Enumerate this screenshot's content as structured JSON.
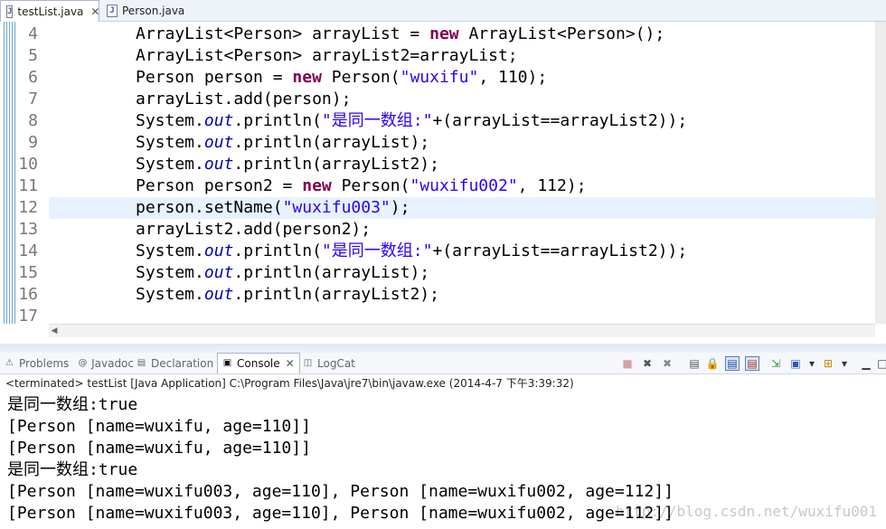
{
  "editor_tabs": [
    {
      "label": "testList.java",
      "icon": "java-file-icon",
      "active": true,
      "close": "✕"
    },
    {
      "label": "Person.java",
      "icon": "java-file-icon",
      "active": false
    }
  ],
  "code_lines": [
    {
      "num": "4",
      "segments": [
        [
          "ArrayList<Person> arrayList = ",
          "p"
        ],
        [
          "new",
          "kw"
        ],
        [
          " ArrayList<Person>();",
          "p"
        ]
      ]
    },
    {
      "num": "5",
      "segments": [
        [
          "ArrayList<Person> arrayList2=arrayList;",
          "p"
        ]
      ]
    },
    {
      "num": "6",
      "segments": [
        [
          "Person person = ",
          "p"
        ],
        [
          "new",
          "kw"
        ],
        [
          " Person(",
          "p"
        ],
        [
          "\"wuxifu\"",
          "str"
        ],
        [
          ", 110);",
          "p"
        ]
      ]
    },
    {
      "num": "7",
      "segments": [
        [
          "arrayList.add(person);",
          "p"
        ]
      ]
    },
    {
      "num": "8",
      "segments": [
        [
          "System.",
          "p"
        ],
        [
          "out",
          "fld"
        ],
        [
          ".println(",
          "p"
        ],
        [
          "\"是同一数组:\"",
          "str"
        ],
        [
          "+(arrayList==arrayList2));",
          "p"
        ]
      ]
    },
    {
      "num": "9",
      "segments": [
        [
          "System.",
          "p"
        ],
        [
          "out",
          "fld"
        ],
        [
          ".println(arrayList);",
          "p"
        ]
      ]
    },
    {
      "num": "10",
      "segments": [
        [
          "System.",
          "p"
        ],
        [
          "out",
          "fld"
        ],
        [
          ".println(arrayList2);",
          "p"
        ]
      ]
    },
    {
      "num": "11",
      "segments": [
        [
          "Person person2 = ",
          "p"
        ],
        [
          "new",
          "kw"
        ],
        [
          " Person(",
          "p"
        ],
        [
          "\"wuxifu002\"",
          "str"
        ],
        [
          ", 112);",
          "p"
        ]
      ]
    },
    {
      "num": "12",
      "current": true,
      "segments": [
        [
          "person.setName(",
          "p"
        ],
        [
          "\"wuxifu003\"",
          "str"
        ],
        [
          ");",
          "p"
        ]
      ]
    },
    {
      "num": "13",
      "segments": [
        [
          "arrayList2.add(person2);",
          "p"
        ]
      ]
    },
    {
      "num": "14",
      "segments": [
        [
          "System.",
          "p"
        ],
        [
          "out",
          "fld"
        ],
        [
          ".println(",
          "p"
        ],
        [
          "\"是同一数组:\"",
          "str"
        ],
        [
          "+(arrayList==arrayList2));",
          "p"
        ]
      ]
    },
    {
      "num": "15",
      "segments": [
        [
          "System.",
          "p"
        ],
        [
          "out",
          "fld"
        ],
        [
          ".println(arrayList);",
          "p"
        ]
      ]
    },
    {
      "num": "16",
      "segments": [
        [
          "System.",
          "p"
        ],
        [
          "out",
          "fld"
        ],
        [
          ".println(arrayList2);",
          "p"
        ]
      ]
    },
    {
      "num": "17",
      "segments": []
    }
  ],
  "view_tabs": [
    {
      "label": "Problems",
      "icon": "problems-icon",
      "glyph": "⚠"
    },
    {
      "label": "Javadoc",
      "icon": "javadoc-icon",
      "glyph": "@"
    },
    {
      "label": "Declaration",
      "icon": "declaration-icon",
      "glyph": "▤"
    },
    {
      "label": "Console",
      "icon": "console-icon",
      "glyph": "▣",
      "active": true,
      "close": "✕"
    },
    {
      "label": "LogCat",
      "icon": "logcat-icon",
      "glyph": "◫"
    }
  ],
  "toolbar": [
    {
      "name": "terminate-icon",
      "glyph": "■",
      "color": "#d9a0a0"
    },
    {
      "name": "remove-launch-icon",
      "glyph": "✖",
      "color": "#555"
    },
    {
      "name": "remove-all-terminated-icon",
      "glyph": "✖",
      "color": "#888"
    },
    {
      "name": "clear-console-icon",
      "glyph": "▤",
      "color": "#555"
    },
    {
      "name": "scroll-lock-icon",
      "glyph": "🔒",
      "color": "#555"
    },
    {
      "name": "show-stdout-icon",
      "glyph": "▤",
      "color": "#1c4a9a",
      "pressed": true
    },
    {
      "name": "show-stderr-icon",
      "glyph": "▤",
      "color": "#b03030",
      "pressed": true
    },
    {
      "name": "pin-console-icon",
      "glyph": "⇲",
      "color": "#3a8a3a"
    },
    {
      "name": "display-console-icon",
      "glyph": "▣",
      "color": "#2a57b3"
    },
    {
      "name": "display-console-dropdown-icon",
      "glyph": "▾",
      "color": "#333"
    },
    {
      "name": "open-console-icon",
      "glyph": "⊞",
      "color": "#c48a00"
    },
    {
      "name": "open-console-dropdown-icon",
      "glyph": "▾",
      "color": "#333"
    },
    {
      "name": "minimize-icon",
      "glyph": "▁",
      "color": "#333"
    },
    {
      "name": "maximize-icon",
      "glyph": "□",
      "color": "#333"
    }
  ],
  "console": {
    "status": "<terminated> testList [Java Application] C:\\Program Files\\Java\\jre7\\bin\\javaw.exe (2014-4-7 下午3:39:32)",
    "lines": [
      "是同一数组:true",
      "[Person [name=wuxifu, age=110]]",
      "[Person [name=wuxifu, age=110]]",
      "是同一数组:true",
      "[Person [name=wuxifu003, age=110], Person [name=wuxifu002, age=112]]",
      "[Person [name=wuxifu003, age=110], Person [name=wuxifu002, age=112]]"
    ],
    "watermark": "http://blog.csdn.net/wuxifu001"
  }
}
